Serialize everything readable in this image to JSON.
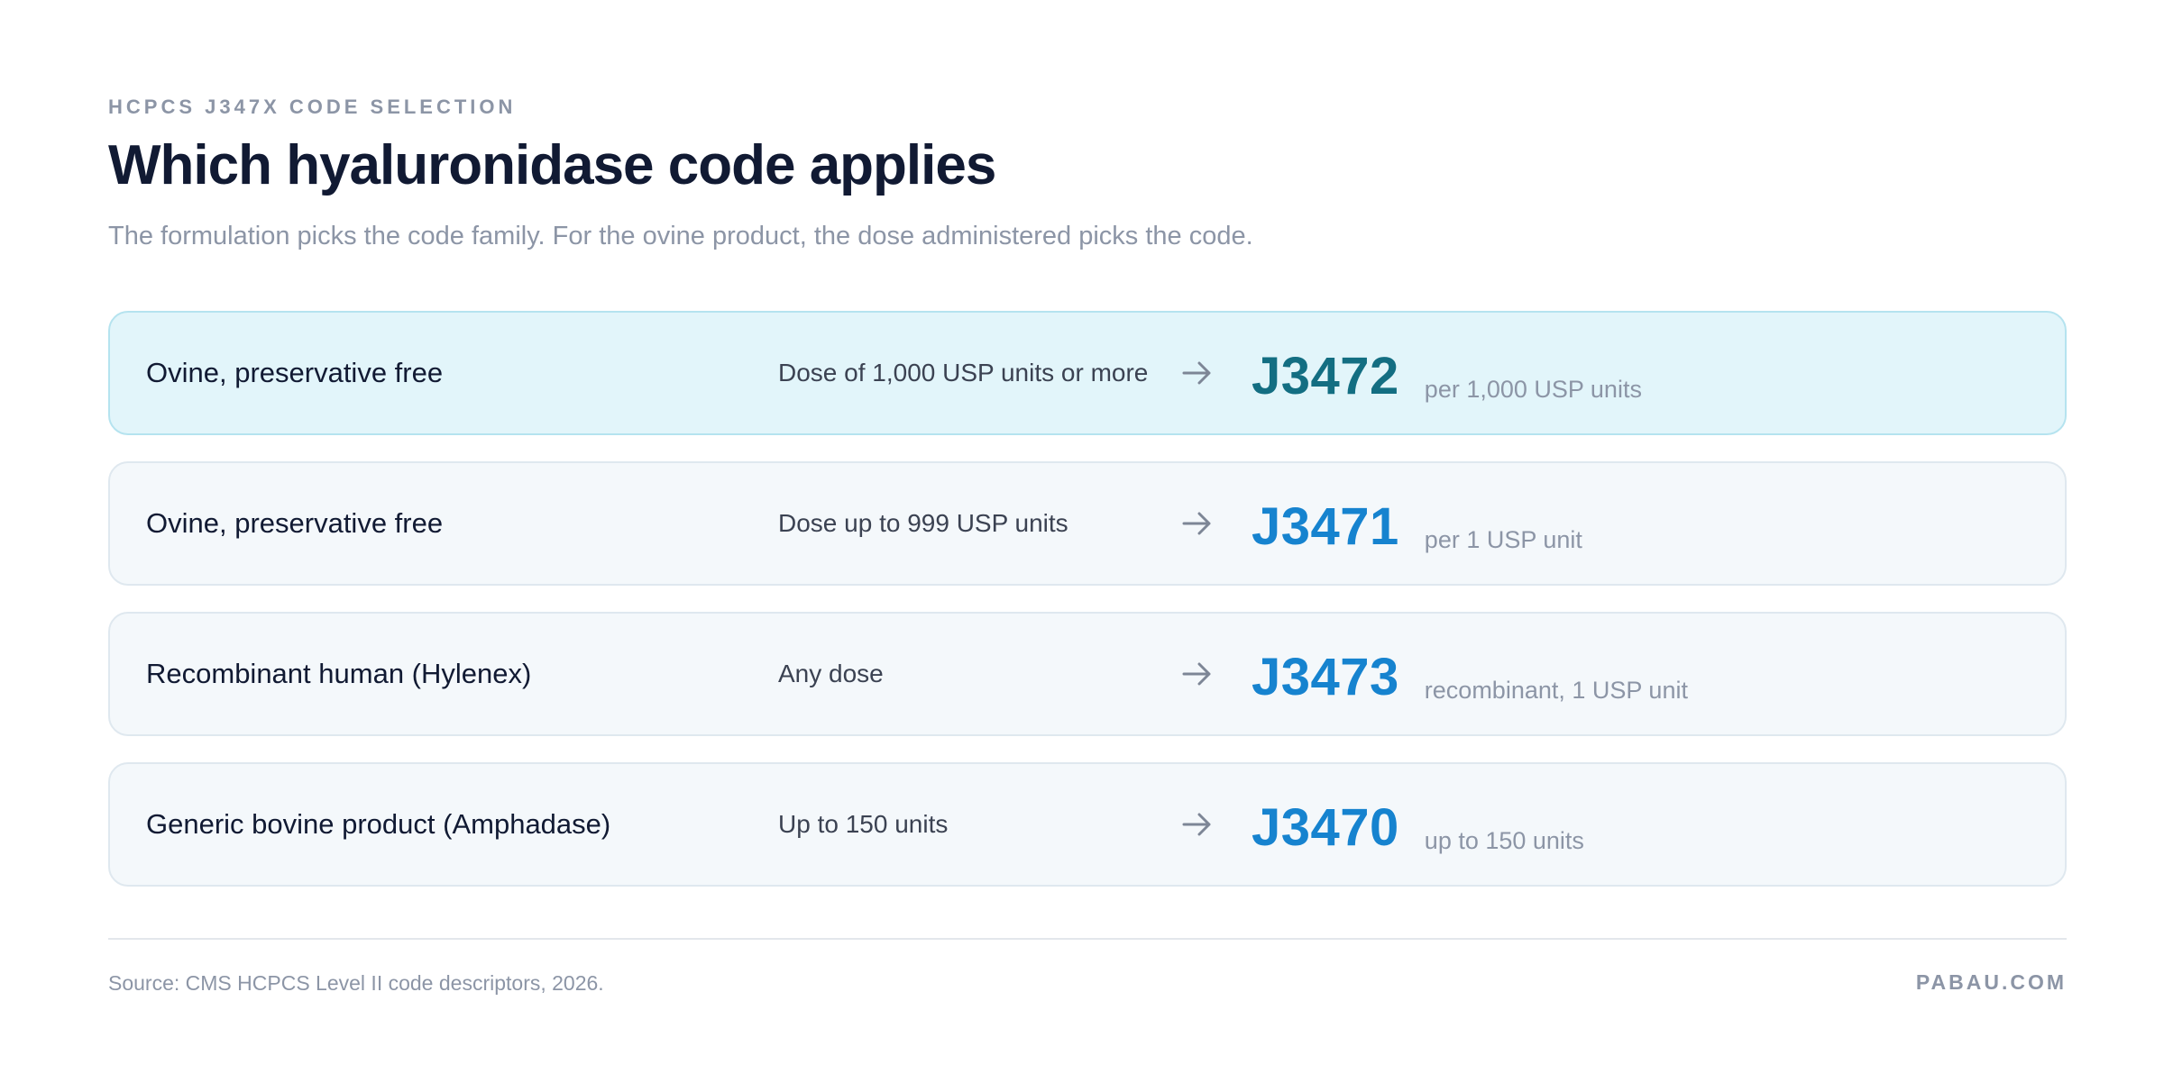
{
  "header": {
    "eyebrow": "HCPCS J347X CODE SELECTION",
    "title": "Which hyaluronidase code applies",
    "subtitle": "The formulation picks the code family. For the ovine product, the dose administered picks the code."
  },
  "rows": [
    {
      "formulation": "Ovine, preservative free",
      "dose": "Dose of 1,000 USP units or more",
      "arrow_icon": "arrow-right-icon",
      "code": "J3472",
      "note": "per 1,000 USP units",
      "highlighted": true
    },
    {
      "formulation": "Ovine, preservative free",
      "dose": "Dose up to 999 USP units",
      "arrow_icon": "arrow-right-icon",
      "code": "J3471",
      "note": "per 1 USP unit",
      "highlighted": false
    },
    {
      "formulation": "Recombinant human (Hylenex)",
      "dose": "Any dose",
      "arrow_icon": "arrow-right-icon",
      "code": "J3473",
      "note": "recombinant, 1 USP unit",
      "highlighted": false
    },
    {
      "formulation": "Generic bovine product (Amphadase)",
      "dose": "Up to 150 units",
      "arrow_icon": "arrow-right-icon",
      "code": "J3470",
      "note": "up to 150 units",
      "highlighted": false
    }
  ],
  "footer": {
    "source": "Source: CMS HCPCS Level II code descriptors, 2026.",
    "brand": "PABAU.COM"
  },
  "colors": {
    "highlight_background": "#e2f5fa",
    "highlight_code": "#136e82",
    "code": "#1683cf",
    "muted_text": "#8c95a6",
    "title_text": "#111a33"
  }
}
